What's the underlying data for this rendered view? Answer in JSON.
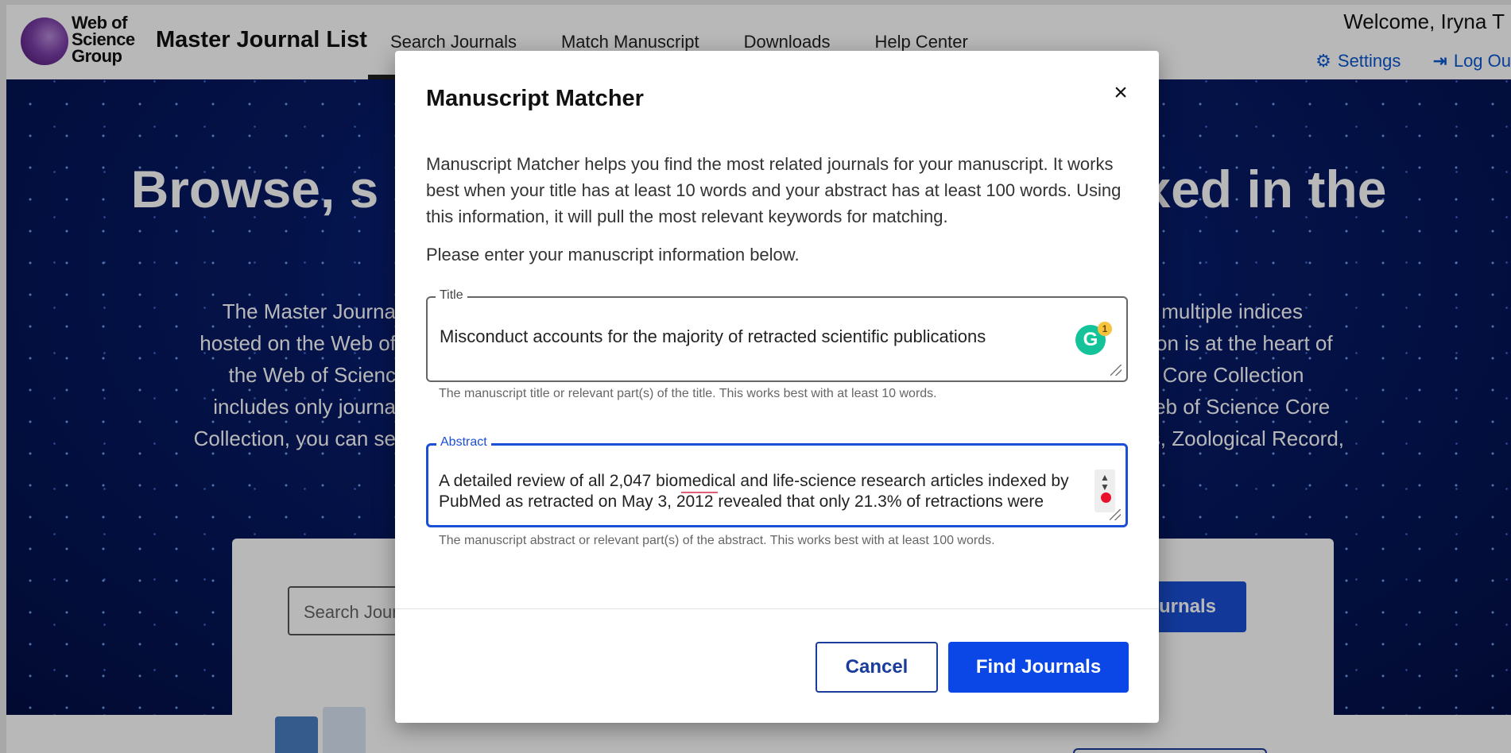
{
  "header": {
    "logo_text": [
      "Web of",
      "Science",
      "Group"
    ],
    "app_title": "Master Journal List",
    "nav": [
      "Search Journals",
      "Match Manuscript",
      "Downloads",
      "Help Center"
    ],
    "welcome": "Welcome, Iryna T",
    "settings_label": "Settings",
    "logout_label": "Log Ou"
  },
  "hero": {
    "title_left": "Browse, s",
    "title_right": "xed in the",
    "text_left": [
      "The Master Journa",
      "hosted on the Web of",
      "the Web of Scienc",
      "includes only journa",
      "Collection, you can se"
    ],
    "text_right": [
      "ss multiple indices",
      "ction is at the heart of",
      "ce Core Collection",
      "Web of Science Core",
      "ws, Zoological Record,"
    ],
    "search_placeholder": "Search Journ",
    "search_button": "Journals"
  },
  "modal": {
    "title": "Manuscript Matcher",
    "close_symbol": "×",
    "intro": "Manuscript Matcher helps you find the most related journals for your manuscript. It works best when your title has at least 10 words and your abstract has at least 100 words. Using this information, it will pull the most relevant keywords for matching.",
    "prompt": "Please enter your manuscript information below.",
    "title_field": {
      "label": "Title",
      "value": "Misconduct accounts for the majority of retracted scientific publications",
      "helper": "The manuscript title or relevant part(s) of the title. This works best with at least 10 words.",
      "grammarly_count": "1"
    },
    "abstract_field": {
      "label": "Abstract",
      "value": "A detailed review of all 2,047 biomedical and life-science research articles indexed by PubMed as retracted on May 3, 2012 revealed that only 21.3% of retractions were",
      "helper": "The manuscript abstract or relevant part(s) of the abstract. This works best with at least 100 words."
    },
    "cancel_label": "Cancel",
    "find_label": "Find Journals"
  },
  "colors": {
    "primary_blue": "#0b47e6",
    "outline_blue": "#1a3c9a",
    "hero_navy": "#061a66",
    "grammarly_green": "#15c39a"
  }
}
